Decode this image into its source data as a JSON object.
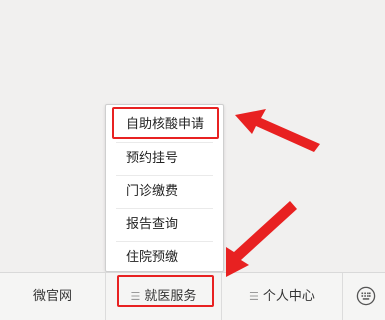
{
  "menu": {
    "items": [
      {
        "label": "自助核酸申请"
      },
      {
        "label": "预约挂号"
      },
      {
        "label": "门诊缴费"
      },
      {
        "label": "报告查询"
      },
      {
        "label": "住院预缴"
      }
    ]
  },
  "bottom_bar": {
    "tabs": [
      {
        "label": "微官网"
      },
      {
        "label": "就医服务",
        "icon": "menu-lines-icon",
        "symbol": "☰"
      },
      {
        "label": "个人中心",
        "icon": "menu-lines-icon",
        "symbol": "☰"
      }
    ],
    "keyboard_icon": "keyboard-icon"
  },
  "annotations": {
    "color": "#e82121"
  }
}
